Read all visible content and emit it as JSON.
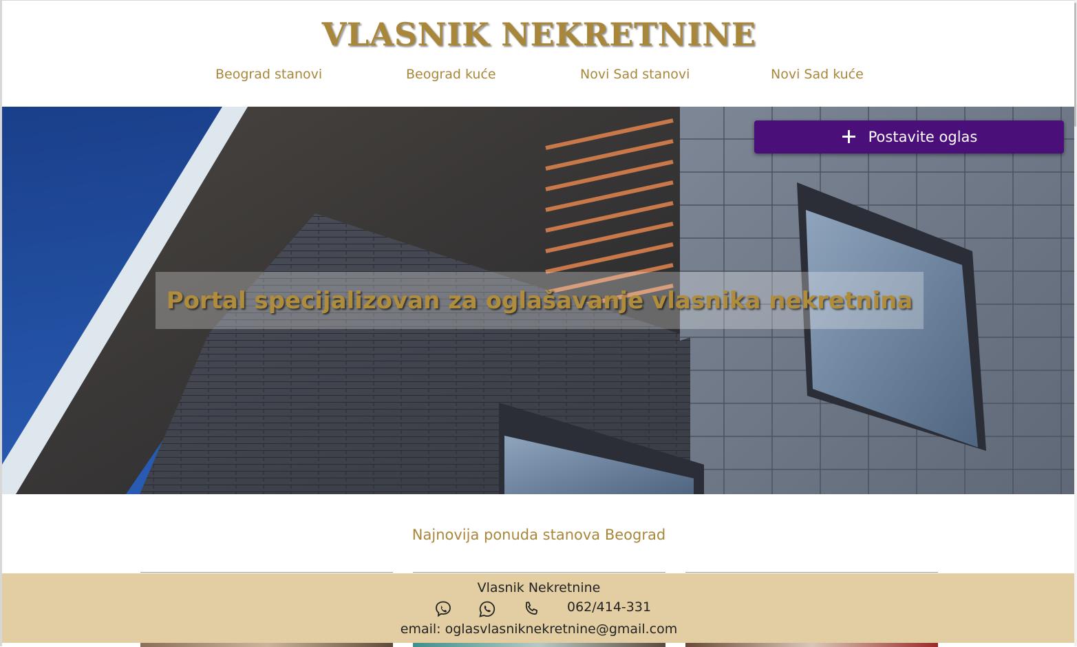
{
  "header": {
    "site_title": "VLASNIK NEKRETNINE",
    "nav": [
      {
        "label": "Beograd stanovi"
      },
      {
        "label": "Beograd kuće"
      },
      {
        "label": "Novi Sad stanovi"
      },
      {
        "label": "Novi Sad kuće"
      }
    ]
  },
  "hero": {
    "post_button_label": "Postavite oglas",
    "tagline": "Portal specijalizovan za oglašavanje vlasnika nekretnina"
  },
  "section": {
    "heading": "Najnovija ponuda stanova Beograd"
  },
  "footer": {
    "name": "Vlasnik Nekretnine",
    "phone": "062/414-331",
    "email_label": "email:",
    "email": "oglasvlasniknekretnine@gmail.com",
    "icons": [
      "viber-icon",
      "whatsapp-icon",
      "phone-icon"
    ]
  },
  "colors": {
    "gold": "#a8873a",
    "purple_button": "#4a0f78",
    "footer_bg": "#e2cea2"
  }
}
